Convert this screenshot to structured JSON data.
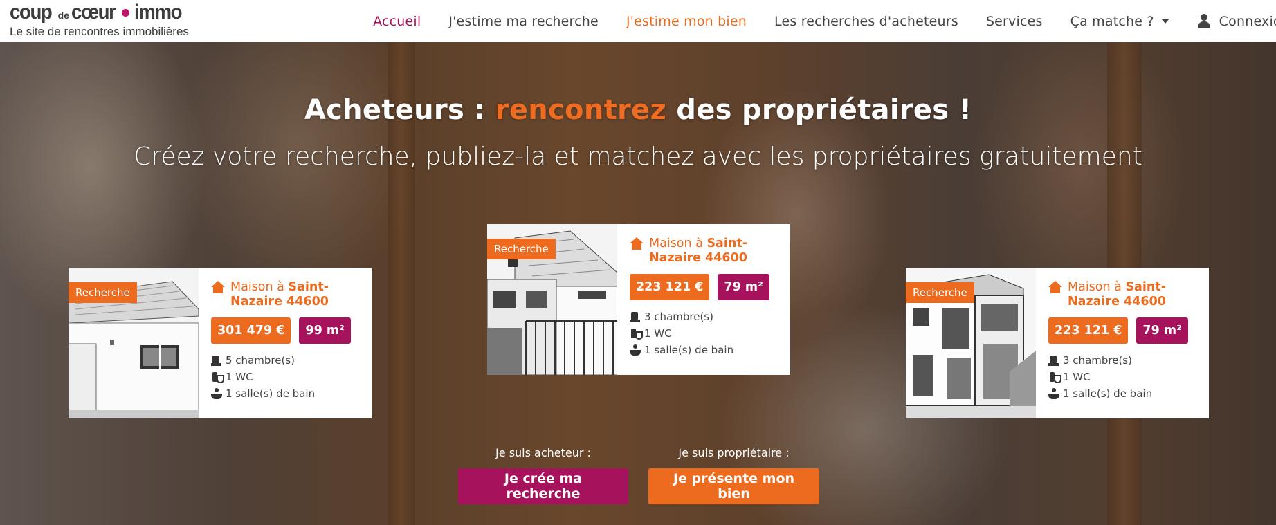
{
  "brand": {
    "logo_part1": "coup",
    "logo_part2": "de",
    "logo_part3": "cœur",
    "logo_part4": "immo",
    "tagline": "Le site de rencontres immobilières"
  },
  "nav": {
    "items": [
      {
        "label": "Accueil"
      },
      {
        "label": "J'estime ma recherche"
      },
      {
        "label": "J'estime mon bien"
      },
      {
        "label": "Les recherches d'acheteurs"
      },
      {
        "label": "Services"
      },
      {
        "label": "Ça matche ?"
      }
    ],
    "login": "Connexion"
  },
  "hero": {
    "title_before": "Acheteurs : ",
    "title_accent": "rencontrez",
    "title_after": " des propriétaires !",
    "subtitle": "Créez votre recherche, publiez-la et matchez avec les propriétaires gratuitement"
  },
  "cards": [
    {
      "badge": "Recherche",
      "type": "Maison à ",
      "city": "Saint-Nazaire 44600",
      "price": "301 479 €",
      "area": "99 m²",
      "bedrooms": "5 chambre(s)",
      "wc": "1 WC",
      "bathrooms": "1 salle(s) de bain"
    },
    {
      "badge": "Recherche",
      "type": "Maison à ",
      "city": "Saint-Nazaire 44600",
      "price": "223 121 €",
      "area": "79 m²",
      "bedrooms": "3 chambre(s)",
      "wc": "1 WC",
      "bathrooms": "1 salle(s) de bain"
    },
    {
      "badge": "Recherche",
      "type": "Maison à ",
      "city": "Saint-Nazaire 44600",
      "price": "223 121 €",
      "area": "79 m²",
      "bedrooms": "3 chambre(s)",
      "wc": "1 WC",
      "bathrooms": "1 salle(s) de bain"
    }
  ],
  "cta": {
    "buyer_label": "Je suis acheteur :",
    "buyer_button": "Je crée ma recherche",
    "owner_label": "Je suis propriétaire :",
    "owner_button": "Je présente mon bien"
  },
  "colors": {
    "orange": "#ec6b1f",
    "purple": "#a6125c"
  }
}
